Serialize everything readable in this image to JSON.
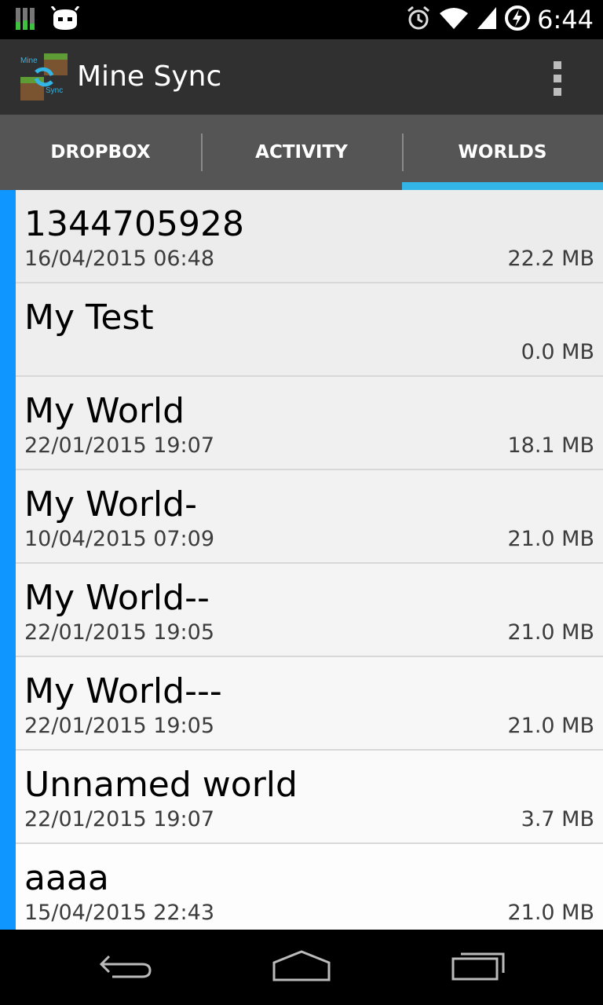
{
  "status_bar": {
    "time": "6:44",
    "icons": [
      "signal-strength-icon",
      "cyanogen-android-icon",
      "alarm-icon",
      "wifi-icon",
      "cell-signal-icon",
      "battery-charging-icon"
    ]
  },
  "app": {
    "title": "Mine Sync",
    "logo_text_top": "Mine",
    "logo_text_bottom": "Sync"
  },
  "tabs": [
    {
      "label": "DROPBOX",
      "active": false
    },
    {
      "label": "ACTIVITY",
      "active": false
    },
    {
      "label": "WORLDS",
      "active": true
    }
  ],
  "worlds": [
    {
      "name": "1344705928",
      "date": "16/04/2015 06:48",
      "size": "22.2 MB"
    },
    {
      "name": "My Test",
      "date": "",
      "size": "0.0 MB"
    },
    {
      "name": "My World",
      "date": "22/01/2015 19:07",
      "size": "18.1 MB"
    },
    {
      "name": "My World-",
      "date": "10/04/2015 07:09",
      "size": "21.0 MB"
    },
    {
      "name": "My World--",
      "date": "22/01/2015 19:05",
      "size": "21.0 MB"
    },
    {
      "name": "My World---",
      "date": "22/01/2015 19:05",
      "size": "21.0 MB"
    },
    {
      "name": "Unnamed world",
      "date": "22/01/2015 19:07",
      "size": "3.7 MB"
    },
    {
      "name": "aaaa",
      "date": "15/04/2015 22:43",
      "size": "21.0 MB"
    }
  ],
  "colors": {
    "accent_stripe": "#0f96ff",
    "tab_indicator": "#33b5e5",
    "action_bar": "#303030",
    "tab_bar": "#555555"
  },
  "nav": {
    "icons": [
      "back-icon",
      "home-icon",
      "recents-icon"
    ]
  }
}
